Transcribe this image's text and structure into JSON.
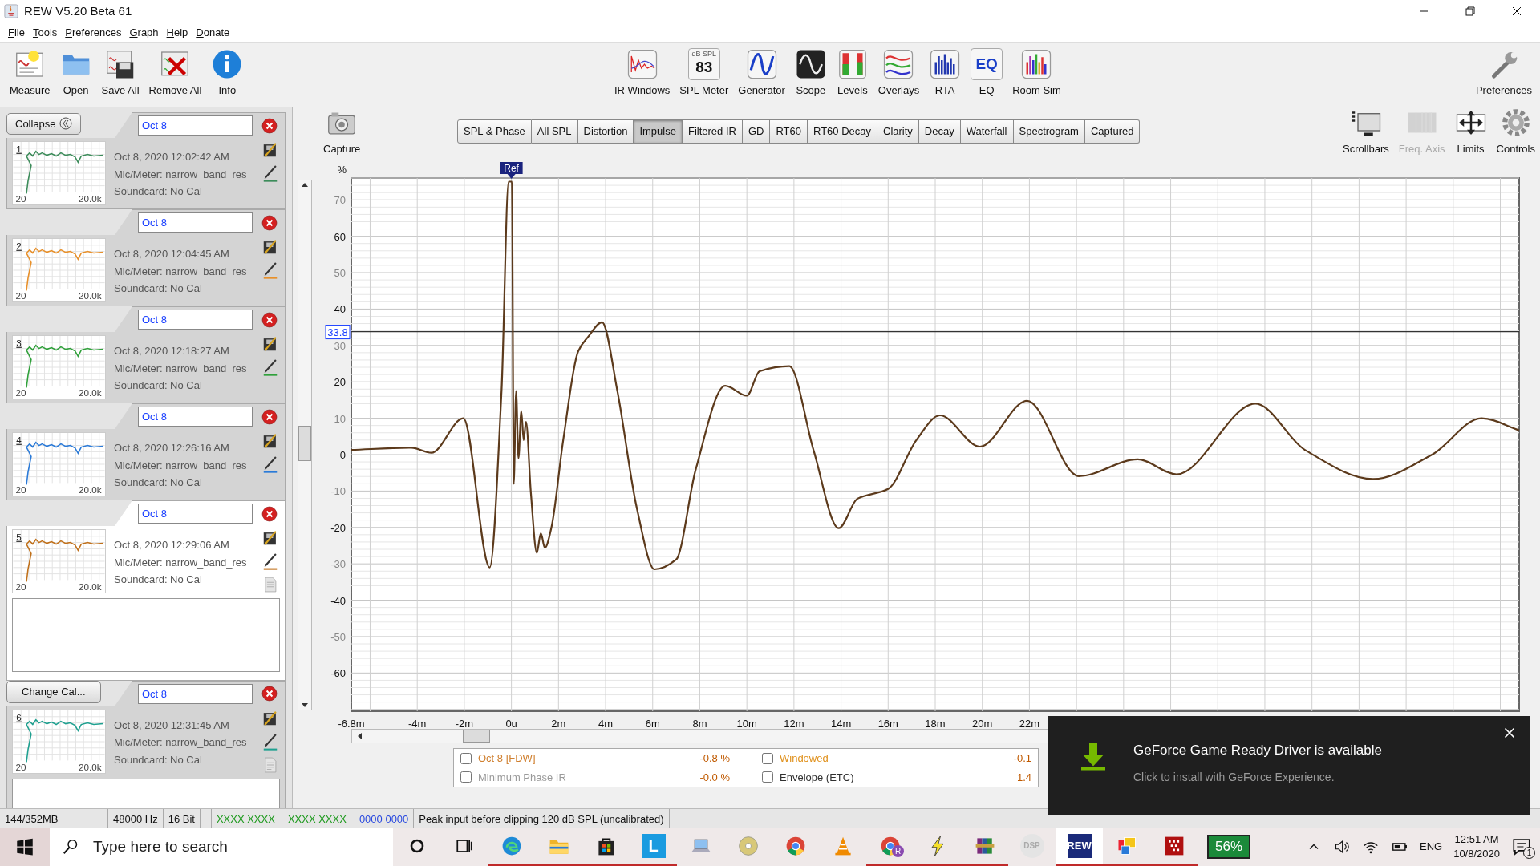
{
  "window": {
    "title": "REW V5.20 Beta 61"
  },
  "menu": [
    {
      "label": "File"
    },
    {
      "label": "Tools"
    },
    {
      "label": "Preferences"
    },
    {
      "label": "Graph"
    },
    {
      "label": "Help"
    },
    {
      "label": "Donate"
    }
  ],
  "toolbar_left": [
    {
      "label": "Measure",
      "kind": "measure"
    },
    {
      "label": "Open",
      "kind": "open"
    },
    {
      "label": "Save All",
      "kind": "saveall"
    },
    {
      "label": "Remove All",
      "kind": "removeall"
    },
    {
      "label": "Info",
      "kind": "info"
    }
  ],
  "toolbar_center": [
    {
      "label": "IR Windows",
      "kind": "irwindows"
    },
    {
      "label": "SPL Meter",
      "kind": "splmeter",
      "display_unit": "dB SPL",
      "display": "83"
    },
    {
      "label": "Generator",
      "kind": "generator"
    },
    {
      "label": "Scope",
      "kind": "scope"
    },
    {
      "label": "Levels",
      "kind": "levels"
    },
    {
      "label": "Overlays",
      "kind": "overlays"
    },
    {
      "label": "RTA",
      "kind": "rta"
    },
    {
      "label": "EQ",
      "kind": "eq",
      "icon_text": "EQ"
    },
    {
      "label": "Room Sim",
      "kind": "roomsim"
    }
  ],
  "toolbar_right": [
    {
      "label": "Preferences",
      "kind": "preferences"
    }
  ],
  "collapse_button": "Collapse",
  "measurements": [
    {
      "number": "1",
      "name": "Oct 8",
      "date": "Oct 8, 2020 12:02:42 AM",
      "mic": "Mic/Meter: narrow_band_res",
      "soundcard": "Soundcard: No Cal",
      "range_start": "20",
      "range_end": "20.0k",
      "color": "#3c8c5a",
      "selected": false,
      "expanded": false
    },
    {
      "number": "2",
      "name": "Oct 8",
      "date": "Oct 8, 2020 12:04:45 AM",
      "mic": "Mic/Meter: narrow_band_res",
      "soundcard": "Soundcard: No Cal",
      "range_start": "20",
      "range_end": "20.0k",
      "color": "#e8902a",
      "selected": false,
      "expanded": false
    },
    {
      "number": "3",
      "name": "Oct 8",
      "date": "Oct 8, 2020 12:18:27 AM",
      "mic": "Mic/Meter: narrow_band_res",
      "soundcard": "Soundcard: No Cal",
      "range_start": "20",
      "range_end": "20.0k",
      "color": "#2fa03a",
      "selected": false,
      "expanded": false
    },
    {
      "number": "4",
      "name": "Oct 8",
      "date": "Oct 8, 2020 12:26:16 AM",
      "mic": "Mic/Meter: narrow_band_res",
      "soundcard": "Soundcard: No Cal",
      "range_start": "20",
      "range_end": "20.0k",
      "color": "#2a7ad8",
      "selected": false,
      "expanded": false
    },
    {
      "number": "5",
      "name": "Oct 8",
      "date": "Oct 8, 2020 12:29:06 AM",
      "mic": "Mic/Meter: narrow_band_res",
      "soundcard": "Soundcard: No Cal",
      "range_start": "20",
      "range_end": "20.0k",
      "color": "#c0701a",
      "selected": true,
      "expanded": true,
      "change_cal": "Change Cal..."
    },
    {
      "number": "6",
      "name": "Oct 8",
      "date": "Oct 8, 2020 12:31:45 AM",
      "mic": "Mic/Meter: narrow_band_res",
      "soundcard": "Soundcard: No Cal",
      "range_start": "20",
      "range_end": "20.0k",
      "color": "#1fa090",
      "selected": false,
      "expanded": true
    }
  ],
  "graph_tools_left": [
    {
      "label": "Capture",
      "kind": "capture"
    }
  ],
  "graph_tabs": [
    {
      "label": "SPL & Phase",
      "selected": false
    },
    {
      "label": "All SPL",
      "selected": false
    },
    {
      "label": "Distortion",
      "selected": false
    },
    {
      "label": "Impulse",
      "selected": true
    },
    {
      "label": "Filtered IR",
      "selected": false
    },
    {
      "label": "GD",
      "selected": false
    },
    {
      "label": "RT60",
      "selected": false
    },
    {
      "label": "RT60 Decay",
      "selected": false
    },
    {
      "label": "Clarity",
      "selected": false
    },
    {
      "label": "Decay",
      "selected": false
    },
    {
      "label": "Waterfall",
      "selected": false
    },
    {
      "label": "Spectrogram",
      "selected": false
    },
    {
      "label": "Captured",
      "selected": false
    }
  ],
  "graph_tools_right": [
    {
      "label": "Scrollbars",
      "kind": "scrollbars",
      "disabled": false
    },
    {
      "label": "Freq. Axis",
      "kind": "freqaxis",
      "disabled": true
    },
    {
      "label": "Limits",
      "kind": "limits",
      "disabled": false
    },
    {
      "label": "Controls",
      "kind": "controls",
      "disabled": false
    }
  ],
  "chart": {
    "ref_label": "Ref",
    "chart_data": {
      "type": "line",
      "ylabel": "%",
      "grid": true,
      "ref_lines": [
        {
          "axis": "y",
          "value": 33.8,
          "label": "33.8"
        }
      ],
      "x": [
        -6.8,
        -4.25,
        -3.4,
        -2.04,
        -0.92,
        -0.42,
        -0.12,
        0.02,
        0.1,
        0.2,
        0.3,
        0.42,
        0.52,
        0.62,
        0.83,
        1.08,
        1.25,
        1.42,
        1.7,
        2.2,
        2.83,
        3.25,
        3.85,
        4.5,
        5.33,
        6.08,
        7.0,
        7.83,
        9.08,
        10.0,
        10.54,
        11.8,
        12.83,
        13.9,
        14.7,
        16.0,
        17.2,
        18.2,
        19.9,
        21.9,
        24.1,
        26.6,
        28.25,
        31.6,
        33.7,
        36.6,
        39.1,
        41.2,
        42.8
      ],
      "series": [
        {
          "color": "#5c3a1c",
          "values": [
            1.3,
            1.9,
            0.5,
            10,
            -31,
            17.5,
            75,
            75,
            -8,
            17.5,
            -1,
            12,
            4,
            9,
            -10.8,
            -27,
            -21.6,
            -25.6,
            -20,
            4,
            28.3,
            32.3,
            36.4,
            17.5,
            -14.8,
            -31.5,
            -28.8,
            -4,
            18.9,
            16.2,
            22.9,
            24.3,
            1.3,
            -20.2,
            -12.1,
            -9.4,
            4,
            10.8,
            2.2,
            14.8,
            -5.9,
            -1.3,
            -5.4,
            14,
            1.3,
            -6.7,
            0,
            10,
            6.7
          ]
        }
      ],
      "xlim": [
        -6.8,
        42.8
      ],
      "ylim": [
        -70.5,
        76
      ],
      "xticks": [
        {
          "value": -6.8,
          "label": "-6.8m"
        },
        {
          "value": -4,
          "label": "-4m"
        },
        {
          "value": -2,
          "label": "-2m"
        },
        {
          "value": 0,
          "label": "0u"
        },
        {
          "value": 2,
          "label": "2m"
        },
        {
          "value": 4,
          "label": "4m"
        },
        {
          "value": 6,
          "label": "6m"
        },
        {
          "value": 8,
          "label": "8m"
        },
        {
          "value": 10,
          "label": "10m"
        },
        {
          "value": 12,
          "label": "12m"
        },
        {
          "value": 14,
          "label": "14m"
        },
        {
          "value": 16,
          "label": "16m"
        },
        {
          "value": 18,
          "label": "18m"
        },
        {
          "value": 20,
          "label": "20m"
        },
        {
          "value": 22,
          "label": "22m"
        }
      ],
      "yticks": [
        -60,
        -50,
        -40,
        -30,
        -20,
        -10,
        0,
        10,
        20,
        30,
        40,
        50,
        60,
        70
      ]
    }
  },
  "legend": [
    {
      "name": "Oct 8 [FDW]",
      "value": "-0.8 %",
      "checked": false,
      "color": "#d08030"
    },
    {
      "name": "Windowed",
      "value": "-0.1",
      "checked": false,
      "color": "#e0901a"
    },
    {
      "name": "Minimum Phase IR",
      "value": "-0.0 %",
      "checked": false,
      "color": "#9a9a9a"
    },
    {
      "name": "Envelope (ETC)",
      "value": "1.4",
      "checked": false,
      "color": "#303030"
    }
  ],
  "status_bar": {
    "memory": "144/352MB",
    "sample_rate": "48000 Hz",
    "bit_depth": "16 Bit",
    "input_indicators": [
      "XXXX XXXX",
      "XXXX XXXX"
    ],
    "output_indicator": "0000 0000",
    "message": "Peak input before clipping 120 dB SPL (uncalibrated)"
  },
  "notification": {
    "title": "GeForce Game Ready Driver is available",
    "text": "Click to install with GeForce Experience."
  },
  "taskbar": {
    "search_placeholder": "Type here to search",
    "apps": [
      {
        "kind": "cortana",
        "running": false,
        "selected": false
      },
      {
        "kind": "taskview",
        "running": false,
        "selected": false
      },
      {
        "kind": "edge",
        "running": true,
        "selected": false
      },
      {
        "kind": "explorer",
        "running": true,
        "selected": false
      },
      {
        "kind": "store",
        "running": true,
        "selected": false
      },
      {
        "kind": "letterapp",
        "label": "L",
        "running": true,
        "selected": false
      },
      {
        "kind": "computer",
        "running": false,
        "selected": false
      },
      {
        "kind": "disc",
        "running": false,
        "selected": false
      },
      {
        "kind": "chrome",
        "running": false,
        "selected": false
      },
      {
        "kind": "vlc",
        "running": false,
        "selected": false
      },
      {
        "kind": "chromeprofile",
        "label": "R",
        "running": true,
        "selected": false
      },
      {
        "kind": "lightning",
        "running": true,
        "selected": false
      },
      {
        "kind": "winrar",
        "running": true,
        "selected": false
      },
      {
        "kind": "dsp",
        "label": "DSP",
        "running": false,
        "selected": false
      },
      {
        "kind": "rew",
        "label": "REW",
        "running": true,
        "selected": true
      },
      {
        "kind": "squares",
        "running": true,
        "selected": false
      },
      {
        "kind": "dots",
        "running": true,
        "selected": false
      }
    ],
    "battery_meter": "56%",
    "language": "ENG",
    "time": "12:51 AM",
    "date": "10/8/2020",
    "notification_count": "1"
  }
}
